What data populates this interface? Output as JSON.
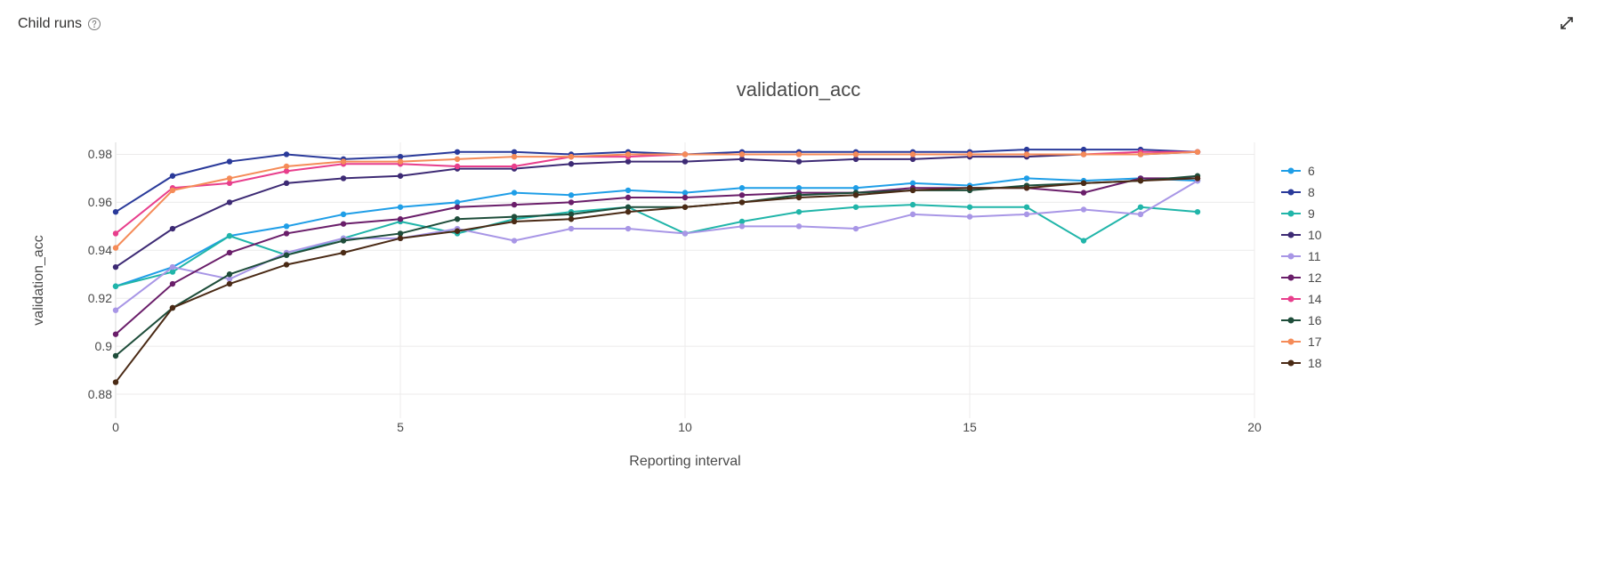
{
  "header": {
    "title": "Child runs",
    "help_icon_name": "help-icon",
    "expand_icon_name": "expand-icon"
  },
  "chart_data": {
    "type": "line",
    "title": "validation_acc",
    "xlabel": "Reporting interval",
    "ylabel": "validation_acc",
    "x": [
      0,
      1,
      2,
      3,
      4,
      5,
      6,
      7,
      8,
      9,
      10,
      11,
      12,
      13,
      14,
      15,
      16,
      17,
      18,
      19
    ],
    "x_ticks": [
      0,
      5,
      10,
      15,
      20
    ],
    "y_ticks": [
      0.88,
      0.9,
      0.92,
      0.94,
      0.96,
      0.98
    ],
    "xlim": [
      0,
      20
    ],
    "ylim": [
      0.87,
      0.985
    ],
    "legend_position": "right",
    "grid": true,
    "series": [
      {
        "name": "6",
        "color": "#1f9ee7",
        "values": [
          0.925,
          0.933,
          0.946,
          0.95,
          0.955,
          0.958,
          0.96,
          0.964,
          0.963,
          0.965,
          0.964,
          0.966,
          0.966,
          0.966,
          0.968,
          0.967,
          0.97,
          0.969,
          0.97,
          0.969
        ]
      },
      {
        "name": "8",
        "color": "#2a3a9a",
        "values": [
          0.956,
          0.971,
          0.977,
          0.98,
          0.978,
          0.979,
          0.981,
          0.981,
          0.98,
          0.981,
          0.98,
          0.981,
          0.981,
          0.981,
          0.981,
          0.981,
          0.982,
          0.982,
          0.982,
          0.981
        ]
      },
      {
        "name": "9",
        "color": "#20b5a9",
        "values": [
          0.925,
          0.931,
          0.946,
          0.938,
          0.945,
          0.952,
          0.947,
          0.953,
          0.956,
          0.958,
          0.947,
          0.952,
          0.956,
          0.958,
          0.959,
          0.958,
          0.958,
          0.944,
          0.958,
          0.956
        ]
      },
      {
        "name": "10",
        "color": "#3d2a74",
        "values": [
          0.933,
          0.949,
          0.96,
          0.968,
          0.97,
          0.971,
          0.974,
          0.974,
          0.976,
          0.977,
          0.977,
          0.978,
          0.977,
          0.978,
          0.978,
          0.979,
          0.979,
          0.98,
          0.98,
          0.981
        ]
      },
      {
        "name": "11",
        "color": "#a896e6",
        "values": [
          0.915,
          0.933,
          0.928,
          0.939,
          0.945,
          0.945,
          0.949,
          0.944,
          0.949,
          0.949,
          0.947,
          0.95,
          0.95,
          0.949,
          0.955,
          0.954,
          0.955,
          0.957,
          0.955,
          0.969
        ]
      },
      {
        "name": "12",
        "color": "#6a1e6a",
        "values": [
          0.905,
          0.926,
          0.939,
          0.947,
          0.951,
          0.953,
          0.958,
          0.959,
          0.96,
          0.962,
          0.962,
          0.963,
          0.964,
          0.964,
          0.966,
          0.966,
          0.966,
          0.964,
          0.97,
          0.97
        ]
      },
      {
        "name": "14",
        "color": "#e83e8c",
        "values": [
          0.947,
          0.966,
          0.968,
          0.973,
          0.976,
          0.976,
          0.975,
          0.975,
          0.979,
          0.979,
          0.98,
          0.98,
          0.98,
          0.98,
          0.98,
          0.98,
          0.98,
          0.98,
          0.981,
          0.981
        ]
      },
      {
        "name": "16",
        "color": "#1e4d3a",
        "values": [
          0.896,
          0.916,
          0.93,
          0.938,
          0.944,
          0.947,
          0.953,
          0.954,
          0.955,
          0.958,
          0.958,
          0.96,
          0.963,
          0.964,
          0.965,
          0.965,
          0.967,
          0.968,
          0.969,
          0.971
        ]
      },
      {
        "name": "17",
        "color": "#f58b58",
        "values": [
          0.941,
          0.965,
          0.97,
          0.975,
          0.977,
          0.977,
          0.978,
          0.979,
          0.979,
          0.98,
          0.98,
          0.98,
          0.98,
          0.98,
          0.98,
          0.98,
          0.98,
          0.98,
          0.98,
          0.981
        ]
      },
      {
        "name": "18",
        "color": "#4a2a15",
        "values": [
          0.885,
          0.916,
          0.926,
          0.934,
          0.939,
          0.945,
          0.948,
          0.952,
          0.953,
          0.956,
          0.958,
          0.96,
          0.962,
          0.963,
          0.965,
          0.966,
          0.966,
          0.968,
          0.969,
          0.97
        ]
      }
    ]
  }
}
